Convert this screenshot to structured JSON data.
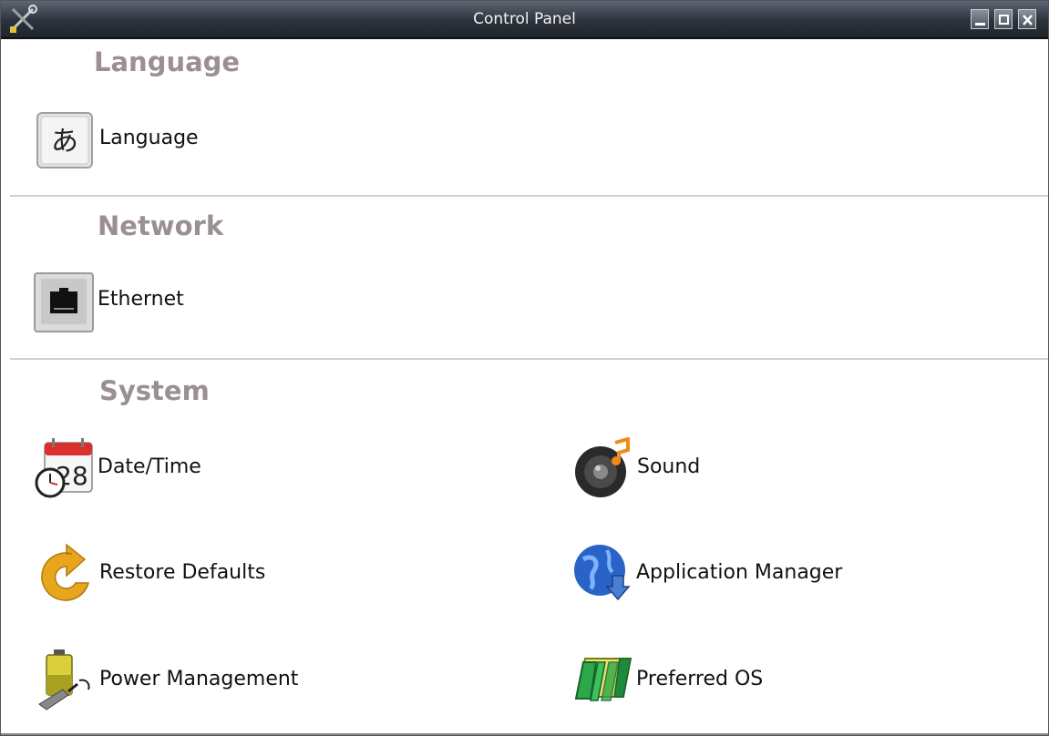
{
  "window": {
    "title": "Control Panel",
    "app_icon": "tools-icon",
    "buttons": {
      "minimize": "minimize-icon",
      "maximize": "maximize-icon",
      "close": "close-icon"
    }
  },
  "sections": {
    "language": {
      "title": "Language",
      "items": [
        {
          "label": "Language",
          "icon": "language-icon",
          "glyph": "あ"
        }
      ]
    },
    "network": {
      "title": "Network",
      "items": [
        {
          "label": "Ethernet",
          "icon": "ethernet-icon"
        }
      ]
    },
    "system": {
      "title": "System",
      "items": [
        {
          "label": "Date/Time",
          "icon": "calendar-clock-icon",
          "glyph": "28"
        },
        {
          "label": "Sound",
          "icon": "speaker-icon"
        },
        {
          "label": "Restore Defaults",
          "icon": "restore-arrow-icon"
        },
        {
          "label": "Application Manager",
          "icon": "globe-download-icon"
        },
        {
          "label": "Power Management",
          "icon": "battery-plug-icon"
        },
        {
          "label": "Preferred OS",
          "icon": "preferred-os-icon"
        }
      ]
    }
  },
  "colors": {
    "section_title": "#9a8f94",
    "titlebar": "#2c323c",
    "divider": "#d0d0d0"
  }
}
